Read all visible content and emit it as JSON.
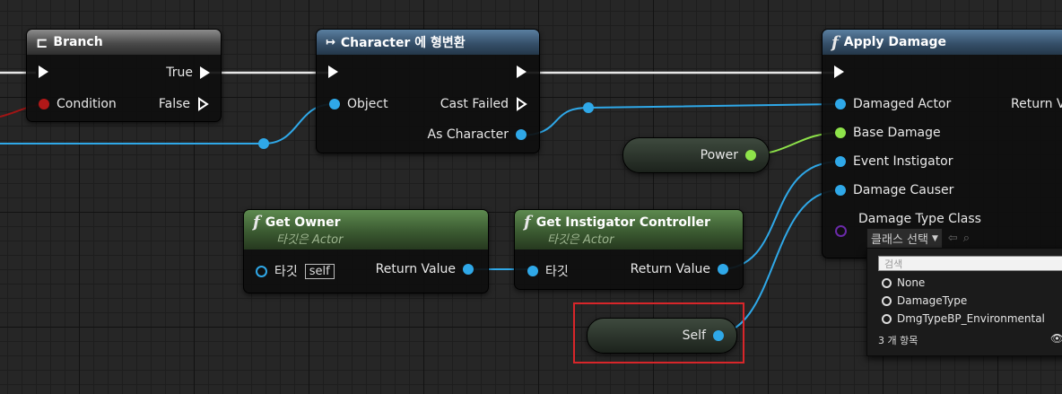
{
  "nodes": {
    "branch": {
      "title": "Branch",
      "pins": {
        "true_label": "True",
        "condition_label": "Condition",
        "false_label": "False"
      }
    },
    "cast": {
      "title": "Character 에 형변환",
      "pins": {
        "object_label": "Object",
        "cast_failed_label": "Cast Failed",
        "as_character_label": "As Character"
      }
    },
    "apply_damage": {
      "title": "Apply Damage",
      "pins": {
        "damaged_actor": "Damaged Actor",
        "base_damage": "Base Damage",
        "event_instigator": "Event Instigator",
        "damage_causer": "Damage Causer",
        "damage_type_class": "Damage Type Class",
        "return_value": "Return V"
      },
      "class_select_value": "클래스 선택"
    },
    "get_owner": {
      "title": "Get Owner",
      "subtitle": "타깃은 Actor",
      "target_label": "타깃",
      "self_value": "self",
      "return_label": "Return Value"
    },
    "get_instigator_controller": {
      "title": "Get Instigator Controller",
      "subtitle": "타깃은 Actor",
      "target_label": "타깃",
      "return_label": "Return Value"
    },
    "power_var": {
      "label": "Power"
    },
    "self_var": {
      "label": "Self"
    }
  },
  "dropdown": {
    "search_placeholder": "검색",
    "items": [
      "None",
      "DamageType",
      "DmgTypeBP_Environmental"
    ],
    "count_text": "3 개 항목"
  },
  "colors": {
    "object_pin": "#2fa8e8",
    "float_pin": "#8ee34a",
    "bool_pin": "#b01818",
    "class_pin": "#6a2aa8",
    "highlight": "#d8262a"
  },
  "icons": {
    "branch": "branch-icon",
    "cast": "cast-icon",
    "function": "function-icon",
    "eye": "eye-icon"
  }
}
